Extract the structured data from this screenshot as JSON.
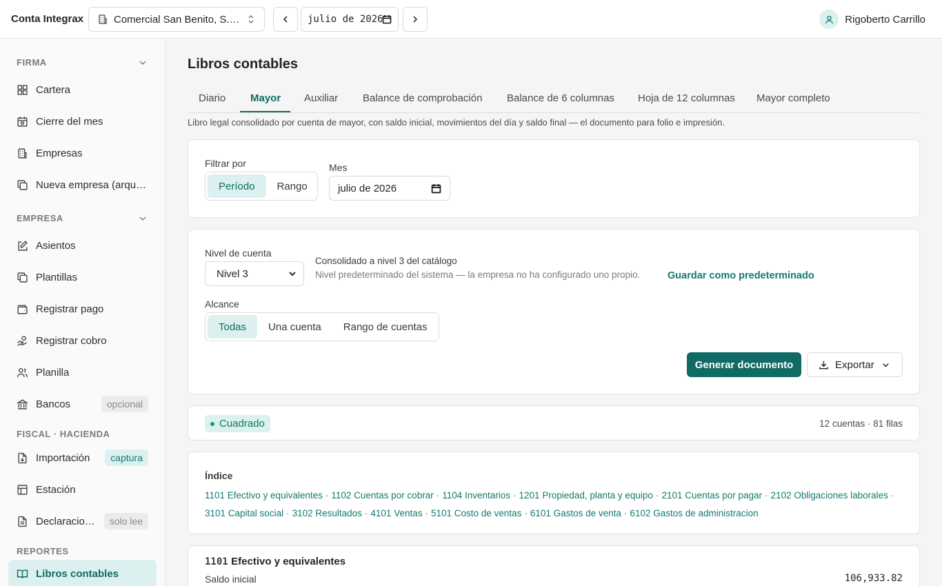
{
  "app": {
    "brand": "Conta Integrax"
  },
  "topbar": {
    "company": "Comercial San Benito, S.…",
    "month_value": "julio de 2026",
    "user_name": "Rigoberto Carrillo"
  },
  "sidebar": {
    "sections": [
      {
        "title": "FIRMA",
        "collapsible": true
      },
      {
        "title": "EMPRESA",
        "collapsible": true
      },
      {
        "title": "FISCAL · HACIENDA",
        "collapsible": false
      },
      {
        "title": "REPORTES",
        "collapsible": false
      }
    ],
    "items": [
      {
        "label": "Cartera",
        "icon": "grid-icon"
      },
      {
        "label": "Cierre del mes",
        "icon": "calendar-icon"
      },
      {
        "label": "Empresas",
        "icon": "building-icon"
      },
      {
        "label": "Nueva empresa (arque…",
        "icon": "copy-icon"
      },
      {
        "label": "Asientos",
        "icon": "edit-icon"
      },
      {
        "label": "Plantillas",
        "icon": "copy-icon"
      },
      {
        "label": "Registrar pago",
        "icon": "wallet-icon"
      },
      {
        "label": "Registrar cobro",
        "icon": "hand-coins-icon"
      },
      {
        "label": "Planilla",
        "icon": "users-icon"
      },
      {
        "label": "Bancos",
        "icon": "bank-icon",
        "badge": "opcional"
      },
      {
        "label": "Importación",
        "icon": "file-import-icon",
        "badge": "captura"
      },
      {
        "label": "Estación",
        "icon": "table-icon"
      },
      {
        "label": "Declaracio…",
        "icon": "file-text-icon",
        "badge": "solo lee"
      },
      {
        "label": "Libros contables",
        "icon": "book-icon",
        "active": true
      }
    ]
  },
  "main": {
    "title": "Libros contables",
    "tabs": [
      "Diario",
      "Mayor",
      "Auxiliar",
      "Balance de comprobación",
      "Balance de 6 columnas",
      "Hoja de 12 columnas",
      "Mayor completo"
    ],
    "active_tab": "Mayor",
    "description": "Libro legal consolidado por cuenta de mayor, con saldo inicial, movimientos del día y saldo final — el documento para folio e impresión."
  },
  "filter": {
    "label": "Filtrar por",
    "options": [
      "Período",
      "Rango"
    ],
    "selected": "Período",
    "month_label": "Mes",
    "month_value": "julio de 2026"
  },
  "options": {
    "level_label": "Nivel de cuenta",
    "level_value": "Nivel 3",
    "level_note_title": "Consolidado a nivel 3 del catálogo",
    "level_note_sub": "Nivel predeterminado del sistema — la empresa no ha configurado uno propio.",
    "save_default": "Guardar como predeterminado",
    "scope_label": "Alcance",
    "scope_options": [
      "Todas",
      "Una cuenta",
      "Rango de cuentas"
    ],
    "scope_selected": "Todas",
    "generate": "Generar documento",
    "export": "Exportar"
  },
  "status": {
    "badge": "Cuadrado",
    "counts": "12 cuentas · 81 filas"
  },
  "index": {
    "title": "Índice",
    "links": [
      "1101 Efectivo y equivalentes",
      "1102 Cuentas por cobrar",
      "1104 Inventarios",
      "1201 Propiedad, planta y equipo",
      "2101 Cuentas por pagar",
      "2102 Obligaciones laborales",
      "3101 Capital social",
      "3102 Resultados",
      "4101 Ventas",
      "5101 Costo de ventas",
      "6101 Gastos de venta",
      "6102 Gastos de administracion"
    ]
  },
  "account": {
    "code": "1101",
    "name": "Efectivo y equivalentes",
    "opening_label": "Saldo inicial",
    "opening_value": "106,933.82"
  },
  "colors": {
    "accent": "#0f6b64",
    "accent_light": "#dcf1ef",
    "success": "#18a05a"
  }
}
